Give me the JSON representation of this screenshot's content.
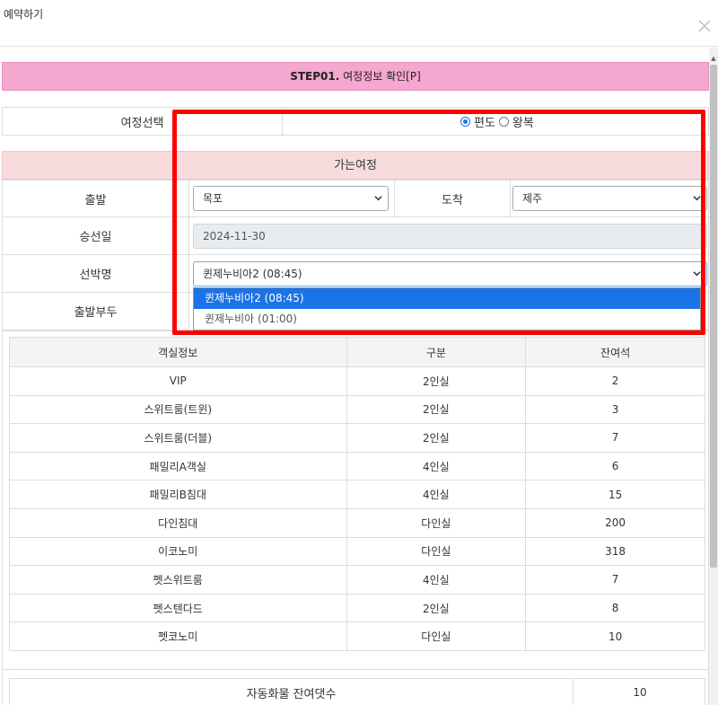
{
  "modal": {
    "title": "예약하기",
    "close_icon": "close-icon"
  },
  "step": {
    "bold": "STEP01.",
    "text": " 여정정보 확인[P]"
  },
  "trip_select": {
    "label": "여정선택",
    "options": [
      {
        "label": "편도",
        "checked": true
      },
      {
        "label": "왕복",
        "checked": false
      }
    ]
  },
  "outbound": {
    "header": "가는여정",
    "departure_label": "출발",
    "departure_value": "목포",
    "arrival_label": "도착",
    "arrival_value": "제주",
    "date_label": "승선일",
    "date_value": "2024-11-30",
    "ship_label": "선박명",
    "ship_value": "퀸제누비아2 (08:45)",
    "pier_label": "출발부두",
    "ship_options": [
      "퀸제누비아2 (08:45)",
      "퀸제누비아 (01:00)"
    ]
  },
  "cabin_table": {
    "headers": [
      "객실정보",
      "구분",
      "잔여석"
    ],
    "rows": [
      [
        "VIP",
        "2인실",
        "2"
      ],
      [
        "스위트룸(트윈)",
        "2인실",
        "3"
      ],
      [
        "스위트룸(더블)",
        "2인실",
        "7"
      ],
      [
        "패밀리A객실",
        "4인실",
        "6"
      ],
      [
        "패밀리B침대",
        "4인실",
        "15"
      ],
      [
        "다인침대",
        "다인실",
        "200"
      ],
      [
        "이코노미",
        "다인실",
        "318"
      ],
      [
        "펫스위트룸",
        "4인실",
        "7"
      ],
      [
        "펫스텐다드",
        "2인실",
        "8"
      ],
      [
        "펫코노미",
        "다인실",
        "10"
      ]
    ]
  },
  "vehicle": {
    "label": "자동화물 잔여댓수",
    "value": "10"
  },
  "colors": {
    "step_bar": "#f4a7cf",
    "section_header": "#f8dcdd",
    "highlight": "#ff0000",
    "selected": "#1a73e8"
  }
}
